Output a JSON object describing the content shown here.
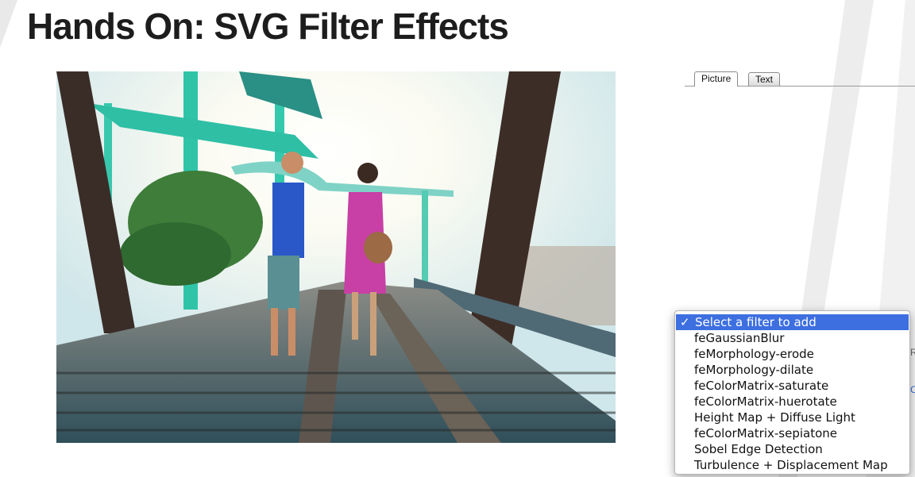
{
  "page": {
    "title": "Hands On: SVG Filter Effects"
  },
  "tabs": [
    {
      "label": "Picture",
      "active": true
    },
    {
      "label": "Text",
      "active": false
    }
  ],
  "filter_menu": {
    "selected_label": "Select a filter to add",
    "check_glyph": "✓",
    "options": [
      "feGaussianBlur",
      "feMorphology-erode",
      "feMorphology-dilate",
      "feColorMatrix-saturate",
      "feColorMatrix-huerotate",
      "Height Map + Diffuse Light",
      "feColorMatrix-sepiatone",
      "Sobel Edge Detection",
      "Turbulence + Displacement Map"
    ]
  },
  "colors": {
    "menu_highlight": "#3d6fe0",
    "title": "#1d1d1d"
  }
}
